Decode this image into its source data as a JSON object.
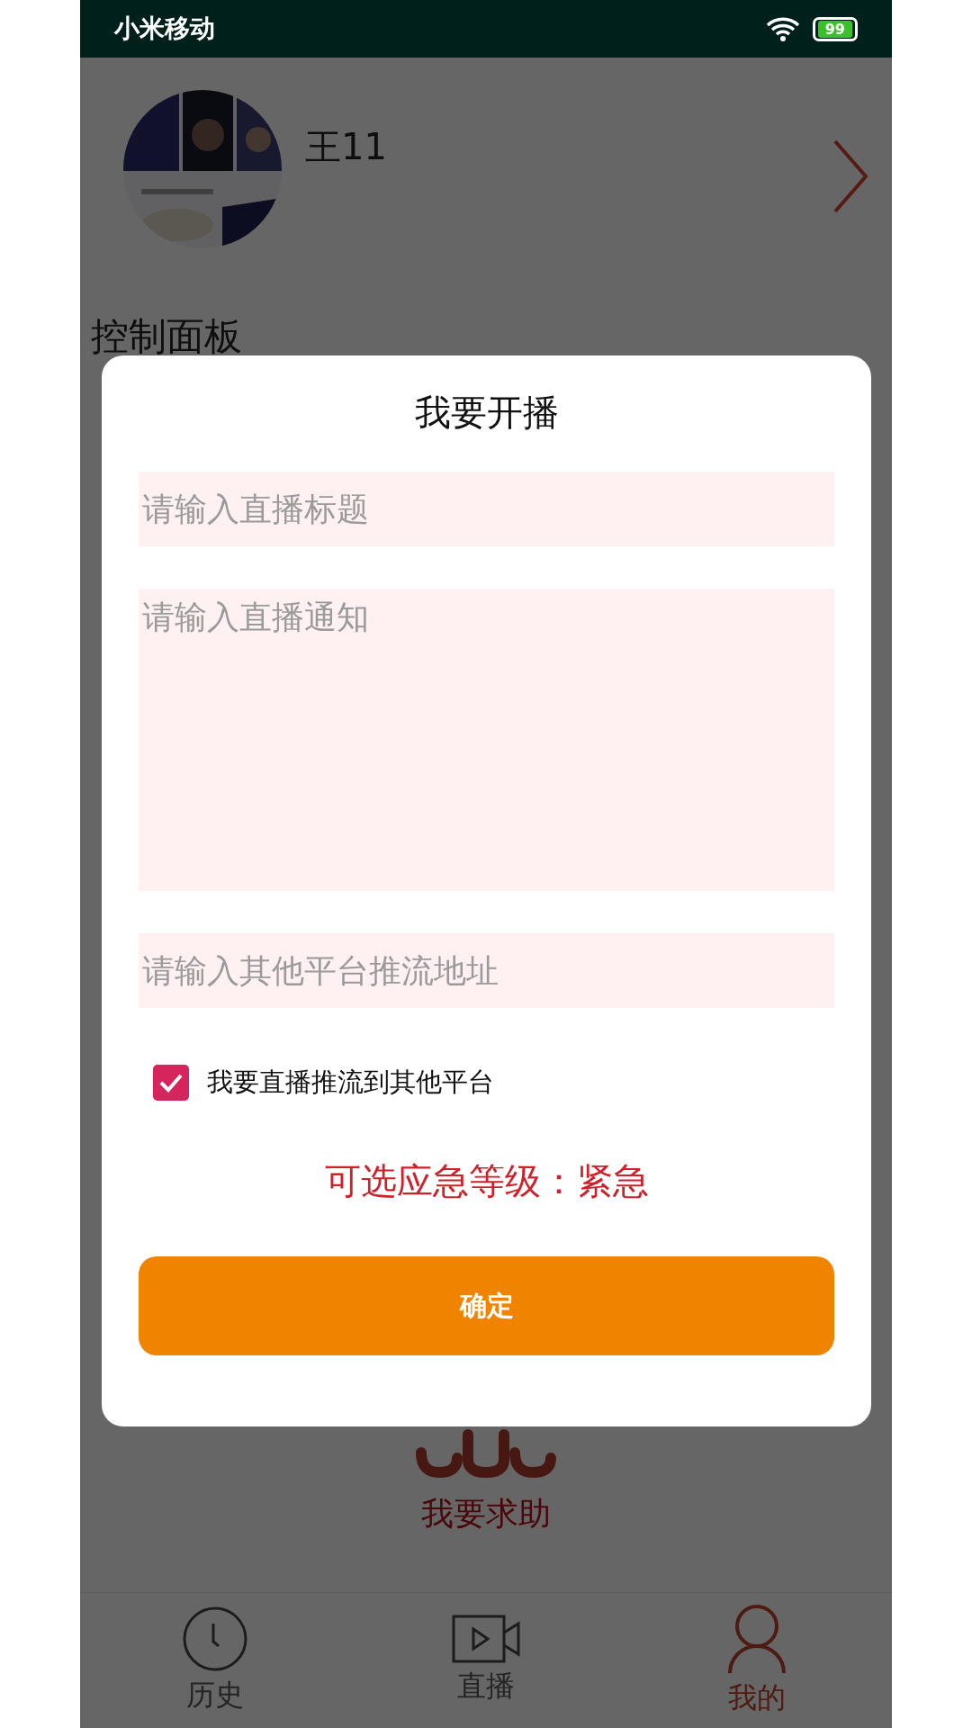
{
  "status_bar": {
    "carrier": "小米移动",
    "battery": "99"
  },
  "profile": {
    "name": "王11"
  },
  "section_title": "控制面板",
  "sos": {
    "label": "我要求助"
  },
  "dialog": {
    "title": "我要开播",
    "fields": [
      {
        "kind": "input",
        "placeholder": "请输入直播标题"
      },
      {
        "kind": "textarea",
        "placeholder": "请输入直播通知"
      },
      {
        "kind": "input",
        "placeholder": "请输入其他平台推流地址"
      }
    ],
    "checkbox": {
      "label": "我要直播推流到其他平台",
      "checked": true
    },
    "level_text": "可选应急等级：紧急",
    "confirm": "确定"
  },
  "tabs": [
    {
      "label": "历史",
      "kind": "clock",
      "selected": false
    },
    {
      "label": "直播",
      "kind": "video",
      "selected": false
    },
    {
      "label": "我的",
      "kind": "user",
      "selected": true
    }
  ]
}
